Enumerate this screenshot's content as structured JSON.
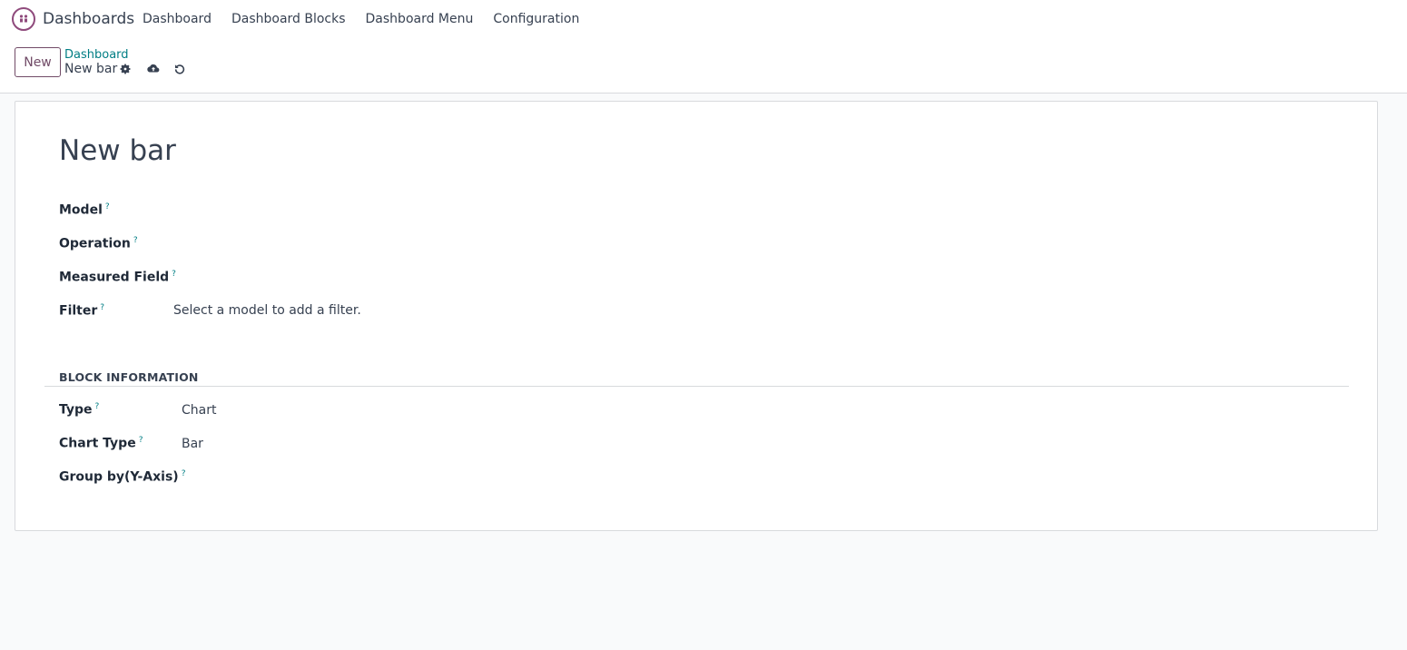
{
  "navbar": {
    "app_name": "Dashboards",
    "menu": [
      {
        "label": "Dashboard"
      },
      {
        "label": "Dashboard Blocks"
      },
      {
        "label": "Dashboard Menu"
      },
      {
        "label": "Configuration"
      }
    ]
  },
  "control_panel": {
    "new_label": "New",
    "breadcrumb": "Dashboard",
    "record_name": "New bar",
    "icons": [
      "gear-icon",
      "cloud-upload-icon",
      "undo-icon"
    ]
  },
  "form": {
    "title": "New bar",
    "help_mark": "?",
    "fields": [
      {
        "label": "Model",
        "value": ""
      },
      {
        "label": "Operation",
        "value": ""
      },
      {
        "label": "Measured Field",
        "value": ""
      },
      {
        "label": "Filter",
        "value": "Select a model to add a filter."
      }
    ],
    "section": {
      "title": "BLOCK INFORMATION",
      "fields": [
        {
          "label": "Type",
          "value": "Chart"
        },
        {
          "label": "Chart Type",
          "value": "Bar"
        },
        {
          "label": "Group by(Y-Axis)",
          "value": ""
        }
      ]
    }
  },
  "colors": {
    "brand": "#714b67",
    "link": "#017e84",
    "text": "#374151",
    "background": "#f9fafb"
  }
}
